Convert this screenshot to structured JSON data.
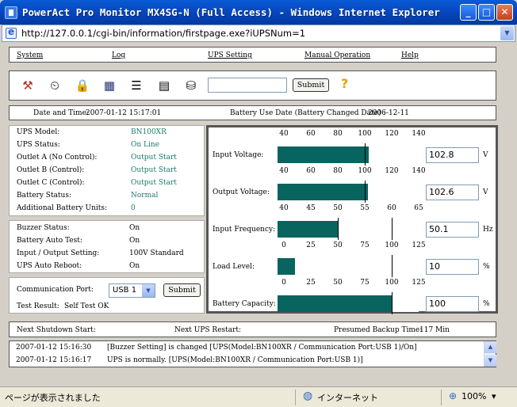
{
  "window": {
    "title": "PowerAct Pro Monitor MX4SG-N (Full Access) - Windows Internet Explorer",
    "min_glyph": "_",
    "max_glyph": "□",
    "close_glyph": "✕"
  },
  "address": {
    "url": "http://127.0.0.1/cgi-bin/information/firstpage.exe?iUPSNum=1",
    "drop_glyph": "▼"
  },
  "menu": {
    "items": [
      "System",
      "Log",
      "UPS Setting",
      "Manual Operation",
      "Help"
    ]
  },
  "toolbar": {
    "search_value": "",
    "submit_label": "Submit",
    "help_glyph": "?",
    "icons": [
      "tools-icon",
      "schedule-icon",
      "lock-icon",
      "table-icon",
      "list-icon",
      "notes-icon",
      "binoculars-icon"
    ],
    "icon_glyphs": [
      "⚒",
      "⏲",
      "🔒",
      "▦",
      "☰",
      "▤",
      "⛁"
    ]
  },
  "datebar": {
    "date_label": "Date and Time:",
    "date_value": "2007-01-12  15:17:01",
    "battery_label": "Battery Use Date (Battery Changed Date) :",
    "battery_value": "2006-12-11"
  },
  "status": [
    {
      "label": "UPS Model:",
      "value": "BN100XR"
    },
    {
      "label": "UPS Status:",
      "value": "On Line"
    },
    {
      "label": "Outlet A (No Control):",
      "value": "Output Start"
    },
    {
      "label": "Outlet B (Control):",
      "value": "Output Start"
    },
    {
      "label": "Outlet C (Control):",
      "value": "Output Start"
    },
    {
      "label": "Battery Status:",
      "value": "Normal"
    },
    {
      "label": "Additional Battery Units:",
      "value": "0"
    }
  ],
  "settings": [
    {
      "label": "Buzzer Status:",
      "value": "On"
    },
    {
      "label": "Battery Auto Test:",
      "value": "On"
    },
    {
      "label": "Input / Output Setting:",
      "value": "100V Standard"
    },
    {
      "label": "UPS Auto Reboot:",
      "value": "On"
    }
  ],
  "comm": {
    "port_label": "Communication Port:",
    "port_value": "USB 1",
    "port_arrow": "▼",
    "submit_label": "Submit",
    "test_label": "Test Result:",
    "test_value": "Self Test OK"
  },
  "meters": [
    {
      "label": "Input Voltage:",
      "scale": [
        "40",
        "60",
        "80",
        "100",
        "120",
        "140"
      ],
      "range": [
        40,
        140
      ],
      "value": 102.8,
      "display": "102.8",
      "unit": "V",
      "marker": 100
    },
    {
      "label": "Output Voltage:",
      "scale": [
        "40",
        "60",
        "80",
        "100",
        "120",
        "140"
      ],
      "range": [
        40,
        140
      ],
      "value": 102.6,
      "display": "102.6",
      "unit": "V",
      "marker": 100
    },
    {
      "label": "Input Frequency:",
      "scale": [
        "40",
        "45",
        "50",
        "55",
        "60",
        "65"
      ],
      "range": [
        40,
        65
      ],
      "value": 50.1,
      "display": "50.1",
      "unit": "Hz",
      "marker": 50,
      "marker2": 60
    },
    {
      "label": "Load Level:",
      "scale": [
        "0",
        "25",
        "50",
        "75",
        "100",
        "125"
      ],
      "range": [
        0,
        125
      ],
      "value": 10,
      "display": "10",
      "unit": "%",
      "marker": 100
    },
    {
      "label": "Battery Capacity:",
      "scale": [
        "0",
        "25",
        "50",
        "75",
        "100",
        "125"
      ],
      "range": [
        0,
        125
      ],
      "value": 100,
      "display": "100",
      "unit": "%",
      "marker": 100
    }
  ],
  "schedule": {
    "shutdown_label": "Next Shutdown Start:",
    "restart_label": "Next UPS Restart:",
    "backup_label": "Presumed Backup Time:",
    "backup_value": "117 Min"
  },
  "log": [
    {
      "time": "2007-01-12 15:16:30",
      "text": "[Buzzer Setting] is changed [UPS(Model:BN100XR / Communication Port:USB 1)/On]"
    },
    {
      "time": "2007-01-12 15:16:17",
      "text": "UPS is normally. [UPS(Model:BN100XR / Communication Port:USB 1)]"
    }
  ],
  "log_scroll": {
    "up_glyph": "▲",
    "down_glyph": "▼"
  },
  "statusbar": {
    "left_text": "ページが表示されました",
    "zone_icon_glyph": "◍",
    "zone_text": "インターネット",
    "zoom_text": "100%",
    "zoom_icon_glyph": "⊕",
    "zoom_arrow": "▾"
  }
}
